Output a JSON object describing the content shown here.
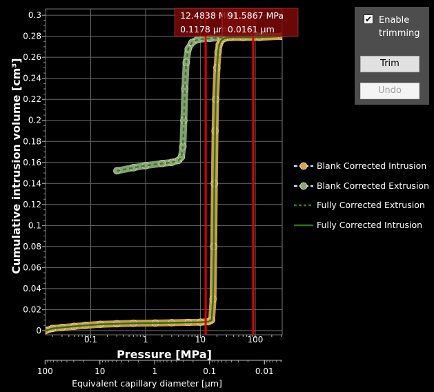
{
  "chart_data": {
    "type": "line",
    "xscale": "log",
    "xlabel": "Pressure [MPa]",
    "ylabel": "Cumulative intrusion volume [cm³]",
    "secondary_xlabel": "Equivalent capillary diameter [µm]",
    "xlim": [
      0.015,
      310
    ],
    "ylim": [
      -0.004,
      0.306
    ],
    "x_ticks": [
      "0.1",
      "1",
      "10",
      "100"
    ],
    "x_tick_values": [
      0.1,
      1,
      10,
      100
    ],
    "y_ticks": [
      "0",
      "0.02",
      "0.04",
      "0.06",
      "0.08",
      "0.1",
      "0.12",
      "0.14",
      "0.16",
      "0.18",
      "0.2",
      "0.22",
      "0.24",
      "0.26",
      "0.28",
      "0.3"
    ],
    "y_tick_values": [
      0,
      0.02,
      0.04,
      0.06,
      0.08,
      0.1,
      0.12,
      0.14,
      0.16,
      0.18,
      0.2,
      0.22,
      0.24,
      0.26,
      0.28,
      0.3
    ],
    "secondary_x_ticks": [
      "100",
      "10",
      "1",
      "0.1",
      "0.01"
    ],
    "secondary_x_tick_values": [
      100,
      10,
      1,
      0.1,
      0.01
    ],
    "grid": true,
    "legend_position": "right",
    "series": [
      {
        "name": "Blank Corrected Intrusion",
        "color": "#d2a64a",
        "style": "marker-line",
        "x": [
          0.015,
          0.02,
          0.03,
          0.05,
          0.08,
          0.15,
          0.3,
          0.6,
          1.5,
          3,
          6,
          10,
          14,
          16,
          17,
          17.5,
          18,
          18.5,
          19,
          20,
          21,
          22,
          24,
          27,
          35,
          60,
          120,
          300
        ],
        "y": [
          0.0,
          0.002,
          0.003,
          0.004,
          0.005,
          0.006,
          0.0065,
          0.007,
          0.0072,
          0.0075,
          0.0078,
          0.008,
          0.0085,
          0.01,
          0.03,
          0.08,
          0.14,
          0.19,
          0.22,
          0.25,
          0.265,
          0.272,
          0.276,
          0.278,
          0.279,
          0.279,
          0.279,
          0.28
        ]
      },
      {
        "name": "Blank Corrected Extrusion",
        "color": "#8aa876",
        "style": "marker-line",
        "x": [
          0.3,
          0.6,
          1,
          2,
          3,
          4,
          4.5,
          4.8,
          5,
          5.2,
          5.5,
          6,
          7,
          9,
          15,
          30,
          60,
          120,
          300
        ],
        "y": [
          0.152,
          0.155,
          0.157,
          0.159,
          0.16,
          0.162,
          0.165,
          0.175,
          0.2,
          0.23,
          0.255,
          0.268,
          0.274,
          0.277,
          0.278,
          0.279,
          0.279,
          0.28,
          0.28
        ]
      },
      {
        "name": "Fully Corrected Extrusion",
        "color": "#3a7a2e",
        "style": "dashed",
        "x": [
          0.3,
          0.6,
          1,
          2,
          3,
          4,
          4.5,
          4.8,
          5,
          5.2,
          5.5,
          6,
          7,
          9,
          15,
          30,
          60,
          120,
          300
        ],
        "y": [
          0.152,
          0.155,
          0.157,
          0.159,
          0.16,
          0.162,
          0.165,
          0.175,
          0.2,
          0.23,
          0.255,
          0.268,
          0.274,
          0.277,
          0.278,
          0.279,
          0.279,
          0.28,
          0.28
        ]
      },
      {
        "name": "Fully Corrected Intrusion",
        "color": "#2f6e1e",
        "style": "solid",
        "x": [
          0.015,
          0.02,
          0.03,
          0.05,
          0.08,
          0.15,
          0.3,
          0.6,
          1.5,
          3,
          6,
          10,
          14,
          16,
          17,
          17.5,
          18,
          18.5,
          19,
          20,
          21,
          22,
          24,
          27,
          35,
          60,
          120,
          300
        ],
        "y": [
          0.0,
          0.002,
          0.003,
          0.004,
          0.005,
          0.006,
          0.0065,
          0.007,
          0.0072,
          0.0075,
          0.0078,
          0.008,
          0.0085,
          0.01,
          0.03,
          0.08,
          0.14,
          0.19,
          0.22,
          0.25,
          0.265,
          0.272,
          0.276,
          0.278,
          0.279,
          0.279,
          0.279,
          0.28
        ]
      }
    ],
    "markers": [
      {
        "pressure": 12.4838,
        "pressure_label": "12.4838 MPa",
        "diameter_label": "0.1178 µm",
        "color": "#e00000"
      },
      {
        "pressure": 91.5867,
        "pressure_label": "91.5867 MPa",
        "diameter_label": "0.0161 µm",
        "color": "#e00000"
      }
    ]
  },
  "trimming": {
    "enable_label": "Enable trimming",
    "enabled": true,
    "trim_button": "Trim",
    "undo_button": "Undo"
  }
}
